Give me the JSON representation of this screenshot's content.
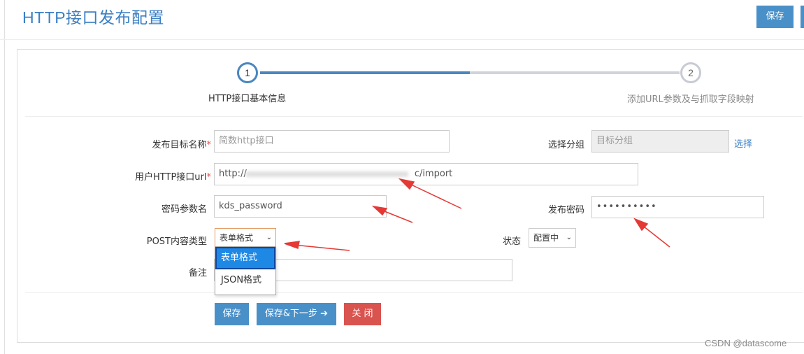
{
  "header": {
    "title": "HTTP接口发布配置",
    "save_label": "保存"
  },
  "stepper": {
    "steps": [
      {
        "number": "1",
        "label": "HTTP接口基本信息",
        "active": true
      },
      {
        "number": "2",
        "label": "添加URL参数及与抓取字段映射",
        "active": false
      }
    ]
  },
  "form": {
    "target_name": {
      "label": "发布目标名称",
      "required": "*",
      "placeholder": "简数http接口"
    },
    "group": {
      "label": "选择分组",
      "placeholder": "目标分组",
      "choose_link": "选择"
    },
    "url": {
      "label": "用户HTTP接口url",
      "required": "*",
      "value_start": "http://",
      "value_end": "c/import"
    },
    "password_param": {
      "label": "密码参数名",
      "value": "kds_password"
    },
    "publish_password": {
      "label": "发布密码",
      "value": "••••••••••"
    },
    "post_type": {
      "label": "POST内容类型",
      "selected": "表单格式",
      "options": [
        "表单格式",
        "JSON格式"
      ]
    },
    "status": {
      "label": "状态",
      "selected": "配置中"
    },
    "remark": {
      "label": "备注",
      "value": ""
    }
  },
  "actions": {
    "save": "保存",
    "save_next": "保存&下一步",
    "close": "关 闭"
  },
  "watermark": "CSDN @datascome",
  "colors": {
    "primary": "#4a90c8",
    "danger": "#d9534f",
    "annotation_arrow": "#e53935"
  }
}
